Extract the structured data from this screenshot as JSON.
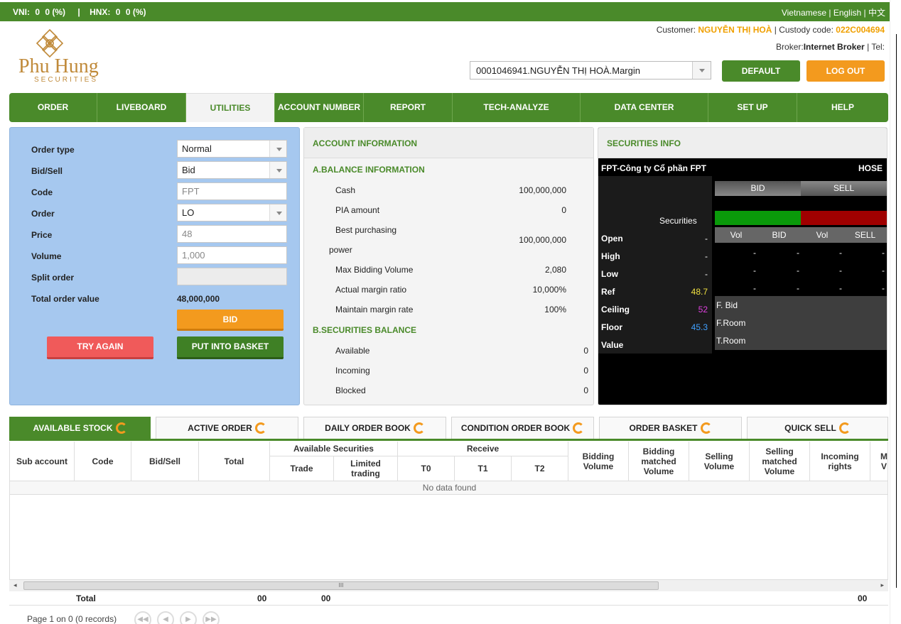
{
  "ticker": {
    "vni_label": "VNI:",
    "vni_value": "0",
    "vni_change": "0 (%)",
    "separator": "|",
    "hnx_label": "HNX:",
    "hnx_value": "0",
    "hnx_change": "0 (%)",
    "lang_vi": "Vietnamese",
    "lang_en": "English",
    "lang_zh": "中文",
    "lang_sep": "|"
  },
  "logo": {
    "brand": "Phu Hung",
    "sub": "SECURITIES"
  },
  "header": {
    "customer_label": "Customer:",
    "customer_name": "NGUYỄN THỊ HOÀ",
    "custody_label": "| Custody code:",
    "custody_code": "022C004694",
    "broker_label": "Broker:",
    "broker_name": "Internet Broker",
    "tel_label": "|  Tel:",
    "account_selected": "0001046941.NGUYỄN THỊ HOÀ.Margin",
    "default_label": "DEFAULT",
    "logout_label": "LOG OUT"
  },
  "nav": [
    {
      "label": "ORDER"
    },
    {
      "label": "LIVEBOARD"
    },
    {
      "label": "UTILITIES",
      "active": true
    },
    {
      "label": "ACCOUNT NUMBER"
    },
    {
      "label": "REPORT"
    },
    {
      "label": "TECH-ANALYZE"
    },
    {
      "label": "DATA CENTER"
    },
    {
      "label": "SET UP"
    },
    {
      "label": "HELP"
    }
  ],
  "order_form": {
    "order_type_label": "Order type",
    "order_type_value": "Normal",
    "bidsell_label": "Bid/Sell",
    "bidsell_value": "Bid",
    "code_label": "Code",
    "code_placeholder": "FPT",
    "order_label": "Order",
    "order_value": "LO",
    "price_label": "Price",
    "price_placeholder": "48",
    "volume_label": "Volume",
    "volume_placeholder": "1,000",
    "split_label": "Split order",
    "total_label": "Total order value",
    "total_value": "48,000,000",
    "bid_button": "BID",
    "try_again_button": "TRY AGAIN",
    "basket_button": "PUT INTO BASKET"
  },
  "account_info": {
    "title": "ACCOUNT INFORMATION",
    "balance_title": "A.BALANCE INFORMATION",
    "cash_label": "Cash",
    "cash_value": "100,000,000",
    "pia_label": "PIA amount",
    "pia_value": "0",
    "bpp_label_1": "Best purchasing",
    "bpp_label_2": "power",
    "bpp_value": "100,000,000",
    "maxbid_label": "Max Bidding Volume",
    "maxbid_value": "2,080",
    "actual_margin_label": "Actual margin ratio",
    "actual_margin_value": "10,000%",
    "maintain_margin_label": "Maintain margin rate",
    "maintain_margin_value": "100%",
    "sec_balance_title": "B.SECURITIES BALANCE",
    "available_label": "Available",
    "available_value": "0",
    "incoming_label": "Incoming",
    "incoming_value": "0",
    "blocked_label": "Blocked",
    "blocked_value": "0"
  },
  "securities_info": {
    "title": "SECURITIES INFO",
    "name": "FPT-Công ty Cổ phần FPT",
    "exchange": "HOSE",
    "securities_label": "Securities",
    "bid_label": "BID",
    "sell_label": "SELL",
    "open_label": "Open",
    "open_value": "-",
    "high_label": "High",
    "high_value": "-",
    "low_label": "Low",
    "low_value": "-",
    "ref_label": "Ref",
    "ref_value": "48.7",
    "ceiling_label": "Ceiling",
    "ceiling_value": "52",
    "floor_label": "Floor",
    "floor_value": "45.3",
    "value_label": "Value",
    "col_vol": "Vol",
    "col_bid": "BID",
    "col_sell": "SELL",
    "dash": "-",
    "fbid_label": "F. Bid",
    "froom_label": "F.Room",
    "troom_label": "T.Room",
    "ref_color": "#f0e040",
    "ceiling_color": "#e040e0",
    "floor_color": "#40a0ff"
  },
  "tabs": [
    {
      "label": "AVAILABLE STOCK",
      "active": true
    },
    {
      "label": "ACTIVE ORDER"
    },
    {
      "label": "DAILY ORDER BOOK"
    },
    {
      "label": "CONDITION ORDER BOOK"
    },
    {
      "label": "ORDER BASKET"
    },
    {
      "label": "QUICK SELL"
    }
  ],
  "table": {
    "sub_account": "Sub account",
    "code": "Code",
    "bidsell": "Bid/Sell",
    "total": "Total",
    "available_securities": "Available Securities",
    "trade": "Trade",
    "limited_trading": "Limited trading",
    "receive": "Receive",
    "t0": "T0",
    "t1": "T1",
    "t2": "T2",
    "bidding_volume": "Bidding Volume",
    "bidding_matched_volume": "Bidding matched Volume",
    "selling_volume": "Selling Volume",
    "selling_matched_volume": "Selling matched Volume",
    "incoming_rights": "Incoming rights",
    "cut_col": "M\nV",
    "no_data": "No data found",
    "scroll_grip": "III",
    "total_label": "Total",
    "total_1": "00",
    "total_2": "00",
    "total_3": "00",
    "pager": "Page 1 on 0 (0 records)"
  }
}
